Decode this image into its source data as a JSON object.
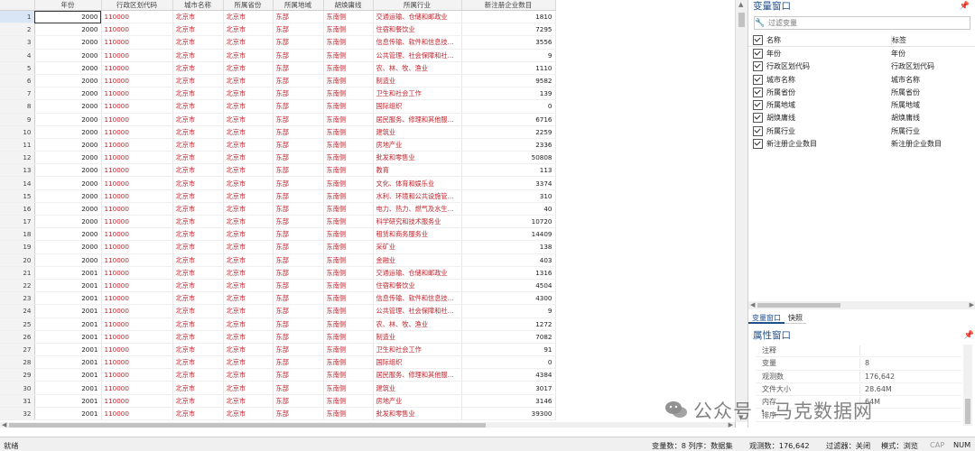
{
  "grid": {
    "columns": [
      "年份",
      "行政区划代码",
      "城市名称",
      "所属省份",
      "所属地域",
      "胡焕庸线",
      "所属行业",
      "新注册企业数目"
    ],
    "rows": [
      [
        "1",
        "2000",
        "110000",
        "北京市",
        "北京市",
        "东部",
        "东南侧",
        "交通运输、仓储和邮政业",
        "1810"
      ],
      [
        "2",
        "2000",
        "110000",
        "北京市",
        "北京市",
        "东部",
        "东南侧",
        "住宿和餐饮业",
        "7295"
      ],
      [
        "3",
        "2000",
        "110000",
        "北京市",
        "北京市",
        "东部",
        "东南侧",
        "信息传输、软件和信息技…",
        "3556"
      ],
      [
        "4",
        "2000",
        "110000",
        "北京市",
        "北京市",
        "东部",
        "东南侧",
        "公共管理、社会保障和社…",
        "9"
      ],
      [
        "5",
        "2000",
        "110000",
        "北京市",
        "北京市",
        "东部",
        "东南侧",
        "农、林、牧、渔业",
        "1110"
      ],
      [
        "6",
        "2000",
        "110000",
        "北京市",
        "北京市",
        "东部",
        "东南侧",
        "制造业",
        "9582"
      ],
      [
        "7",
        "2000",
        "110000",
        "北京市",
        "北京市",
        "东部",
        "东南侧",
        "卫生和社会工作",
        "139"
      ],
      [
        "8",
        "2000",
        "110000",
        "北京市",
        "北京市",
        "东部",
        "东南侧",
        "国际组织",
        "0"
      ],
      [
        "9",
        "2000",
        "110000",
        "北京市",
        "北京市",
        "东部",
        "东南侧",
        "居民服务、修理和其他服…",
        "6716"
      ],
      [
        "10",
        "2000",
        "110000",
        "北京市",
        "北京市",
        "东部",
        "东南侧",
        "建筑业",
        "2259"
      ],
      [
        "11",
        "2000",
        "110000",
        "北京市",
        "北京市",
        "东部",
        "东南侧",
        "房地产业",
        "2336"
      ],
      [
        "12",
        "2000",
        "110000",
        "北京市",
        "北京市",
        "东部",
        "东南侧",
        "批发和零售业",
        "50808"
      ],
      [
        "13",
        "2000",
        "110000",
        "北京市",
        "北京市",
        "东部",
        "东南侧",
        "教育",
        "113"
      ],
      [
        "14",
        "2000",
        "110000",
        "北京市",
        "北京市",
        "东部",
        "东南侧",
        "文化、体育和娱乐业",
        "3374"
      ],
      [
        "15",
        "2000",
        "110000",
        "北京市",
        "北京市",
        "东部",
        "东南侧",
        "水利、环境和公共设施管…",
        "310"
      ],
      [
        "16",
        "2000",
        "110000",
        "北京市",
        "北京市",
        "东部",
        "东南侧",
        "电力、热力、燃气及水生…",
        "40"
      ],
      [
        "17",
        "2000",
        "110000",
        "北京市",
        "北京市",
        "东部",
        "东南侧",
        "科学研究和技术服务业",
        "10720"
      ],
      [
        "18",
        "2000",
        "110000",
        "北京市",
        "北京市",
        "东部",
        "东南侧",
        "租赁和商务服务业",
        "14409"
      ],
      [
        "19",
        "2000",
        "110000",
        "北京市",
        "北京市",
        "东部",
        "东南侧",
        "采矿业",
        "138"
      ],
      [
        "20",
        "2000",
        "110000",
        "北京市",
        "北京市",
        "东部",
        "东南侧",
        "金融业",
        "403"
      ],
      [
        "21",
        "2001",
        "110000",
        "北京市",
        "北京市",
        "东部",
        "东南侧",
        "交通运输、仓储和邮政业",
        "1316"
      ],
      [
        "22",
        "2001",
        "110000",
        "北京市",
        "北京市",
        "东部",
        "东南侧",
        "住宿和餐饮业",
        "4504"
      ],
      [
        "23",
        "2001",
        "110000",
        "北京市",
        "北京市",
        "东部",
        "东南侧",
        "信息传输、软件和信息技…",
        "4300"
      ],
      [
        "24",
        "2001",
        "110000",
        "北京市",
        "北京市",
        "东部",
        "东南侧",
        "公共管理、社会保障和社…",
        "9"
      ],
      [
        "25",
        "2001",
        "110000",
        "北京市",
        "北京市",
        "东部",
        "东南侧",
        "农、林、牧、渔业",
        "1272"
      ],
      [
        "26",
        "2001",
        "110000",
        "北京市",
        "北京市",
        "东部",
        "东南侧",
        "制造业",
        "7082"
      ],
      [
        "27",
        "2001",
        "110000",
        "北京市",
        "北京市",
        "东部",
        "东南侧",
        "卫生和社会工作",
        "91"
      ],
      [
        "28",
        "2001",
        "110000",
        "北京市",
        "北京市",
        "东部",
        "东南侧",
        "国际组织",
        "0"
      ],
      [
        "29",
        "2001",
        "110000",
        "北京市",
        "北京市",
        "东部",
        "东南侧",
        "居民服务、修理和其他服…",
        "4384"
      ],
      [
        "30",
        "2001",
        "110000",
        "北京市",
        "北京市",
        "东部",
        "东南侧",
        "建筑业",
        "3017"
      ],
      [
        "31",
        "2001",
        "110000",
        "北京市",
        "北京市",
        "东部",
        "东南侧",
        "房地产业",
        "3146"
      ],
      [
        "32",
        "2001",
        "110000",
        "北京市",
        "北京市",
        "东部",
        "东南侧",
        "批发和零售业",
        "39300"
      ]
    ],
    "accent_red": "#c0232b"
  },
  "variables_pane": {
    "title": "变量窗口",
    "pin_icon": "pin-icon",
    "filter_placeholder": "过滤变量",
    "header_name": "名称",
    "header_label": "标签",
    "items": [
      {
        "name": "年份",
        "label": "年份"
      },
      {
        "name": "行政区划代码",
        "label": "行政区划代码"
      },
      {
        "name": "城市名称",
        "label": "城市名称"
      },
      {
        "name": "所属省份",
        "label": "所属省份"
      },
      {
        "name": "所属地域",
        "label": "所属地域"
      },
      {
        "name": "胡焕庸线",
        "label": "胡焕庸线"
      },
      {
        "name": "所属行业",
        "label": "所属行业"
      },
      {
        "name": "新注册企业数目",
        "label": "新注册企业数目"
      }
    ]
  },
  "tabs": [
    "变量窗口",
    "快照"
  ],
  "properties_pane": {
    "title": "属性窗口",
    "rows": [
      {
        "key": "注释",
        "value": ""
      },
      {
        "key": "变量",
        "value": "8"
      },
      {
        "key": "观测数",
        "value": "176,642"
      },
      {
        "key": "文件大小",
        "value": "28.64M"
      },
      {
        "key": "内存",
        "value": "64M"
      },
      {
        "key": "排序",
        "value": ""
      }
    ]
  },
  "status_bar": {
    "ready": "就绪",
    "vars": "变量数：8  列序：数据集",
    "obs": "观测数：176,642",
    "filter": "过滤器：关闭",
    "mode": "模式：浏览",
    "cap": "CAP",
    "num": "NUM"
  },
  "watermark": "公众号 · 马克数据网",
  "accent_blue": "#1e4f8a"
}
